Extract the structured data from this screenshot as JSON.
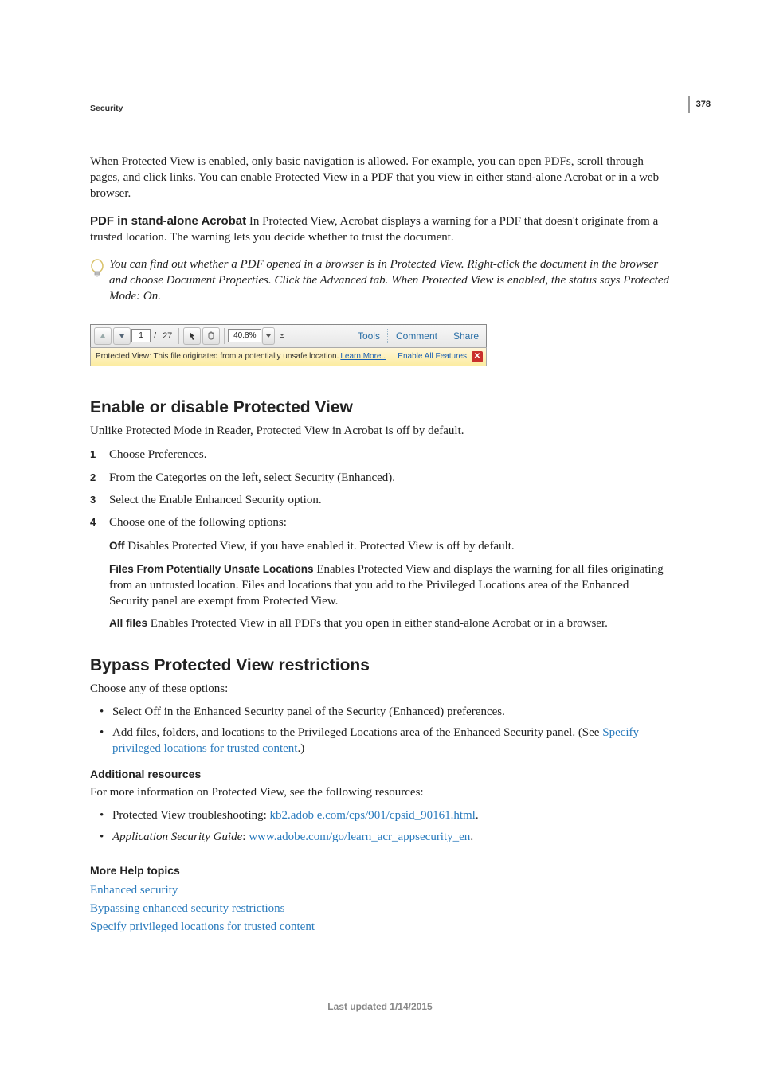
{
  "page_number": "378",
  "breadcrumb": "Security",
  "intro_p1": "When Protected View is enabled, only basic navigation is allowed. For example, you can open PDFs, scroll through pages, and click links. You can enable Protected View in a PDF that you view in either stand-alone Acrobat or in a web browser.",
  "pdf_standalone_label": "PDF in stand-alone Acrobat",
  "pdf_standalone_text": "  In Protected View, Acrobat displays a warning for a PDF that doesn't originate from a trusted location. The warning lets you decide whether to trust the document.",
  "tip_text": "You can find out whether a PDF opened in a browser is in Protected View. Right-click the document in the browser and choose Document Properties. Click the Advanced tab. When Protected View is enabled, the status says Protected Mode: On.",
  "figure": {
    "page_current": "1",
    "page_sep": "/",
    "page_total": "27",
    "zoom": "40.8%",
    "links": {
      "tools": "Tools",
      "comment": "Comment",
      "share": "Share"
    },
    "pv_message": "Protected View: This file originated from a potentially unsafe location.",
    "pv_learn_more": "Learn More..",
    "pv_enable": "Enable All Features",
    "pv_close": "✕"
  },
  "h2_enable": "Enable or disable Protected View",
  "enable_intro": "Unlike Protected Mode in Reader, Protected View in Acrobat is off by default.",
  "steps": [
    "Choose Preferences.",
    "From the Categories on the left, select Security (Enhanced).",
    "Select the Enable Enhanced Security option.",
    "Choose one of the following options:"
  ],
  "opt_off_label": "Off",
  "opt_off_text": "  Disables Protected View, if you have enabled it. Protected View is off by default.",
  "opt_files_label": "Files From Potentially Unsafe Locations",
  "opt_files_text": "  Enables Protected View and displays the warning for all files originating from an untrusted location. Files and locations that you add to the Privileged Locations area of the Enhanced Security panel are exempt from Protected View.",
  "opt_all_label": "All files",
  "opt_all_text": "  Enables Protected View in all PDFs that you open in either stand-alone Acrobat or in a browser.",
  "h2_bypass": "Bypass Protected View restrictions",
  "bypass_intro": "Choose any of these options:",
  "bypass_items": {
    "b1": "Select Off in the Enhanced Security panel of the Security (Enhanced) preferences.",
    "b2_pre": "Add files, folders, and locations to the Privileged Locations area of the Enhanced Security panel. (See ",
    "b2_link": "Specify privileged locations for trusted content",
    "b2_post": ".)"
  },
  "addl_res_label": "Additional resources",
  "addl_res_intro": "For more information on Protected View, see the following resources:",
  "res_items": {
    "r1_pre": "Protected View troubleshooting: ",
    "r1_link": "kb2.adob e.com/cps/901/cpsid_90161.html",
    "r1_post": ".",
    "r2_pre": "Application Security Guide",
    "r2_sep": ": ",
    "r2_link": "www.adobe.com/go/learn_acr_appsecurity_en",
    "r2_post": "."
  },
  "more_help_label": "More Help topics",
  "more_help": [
    "Enhanced security",
    "Bypassing enhanced security restrictions",
    "Specify privileged locations for trusted content"
  ],
  "footer": "Last updated 1/14/2015"
}
